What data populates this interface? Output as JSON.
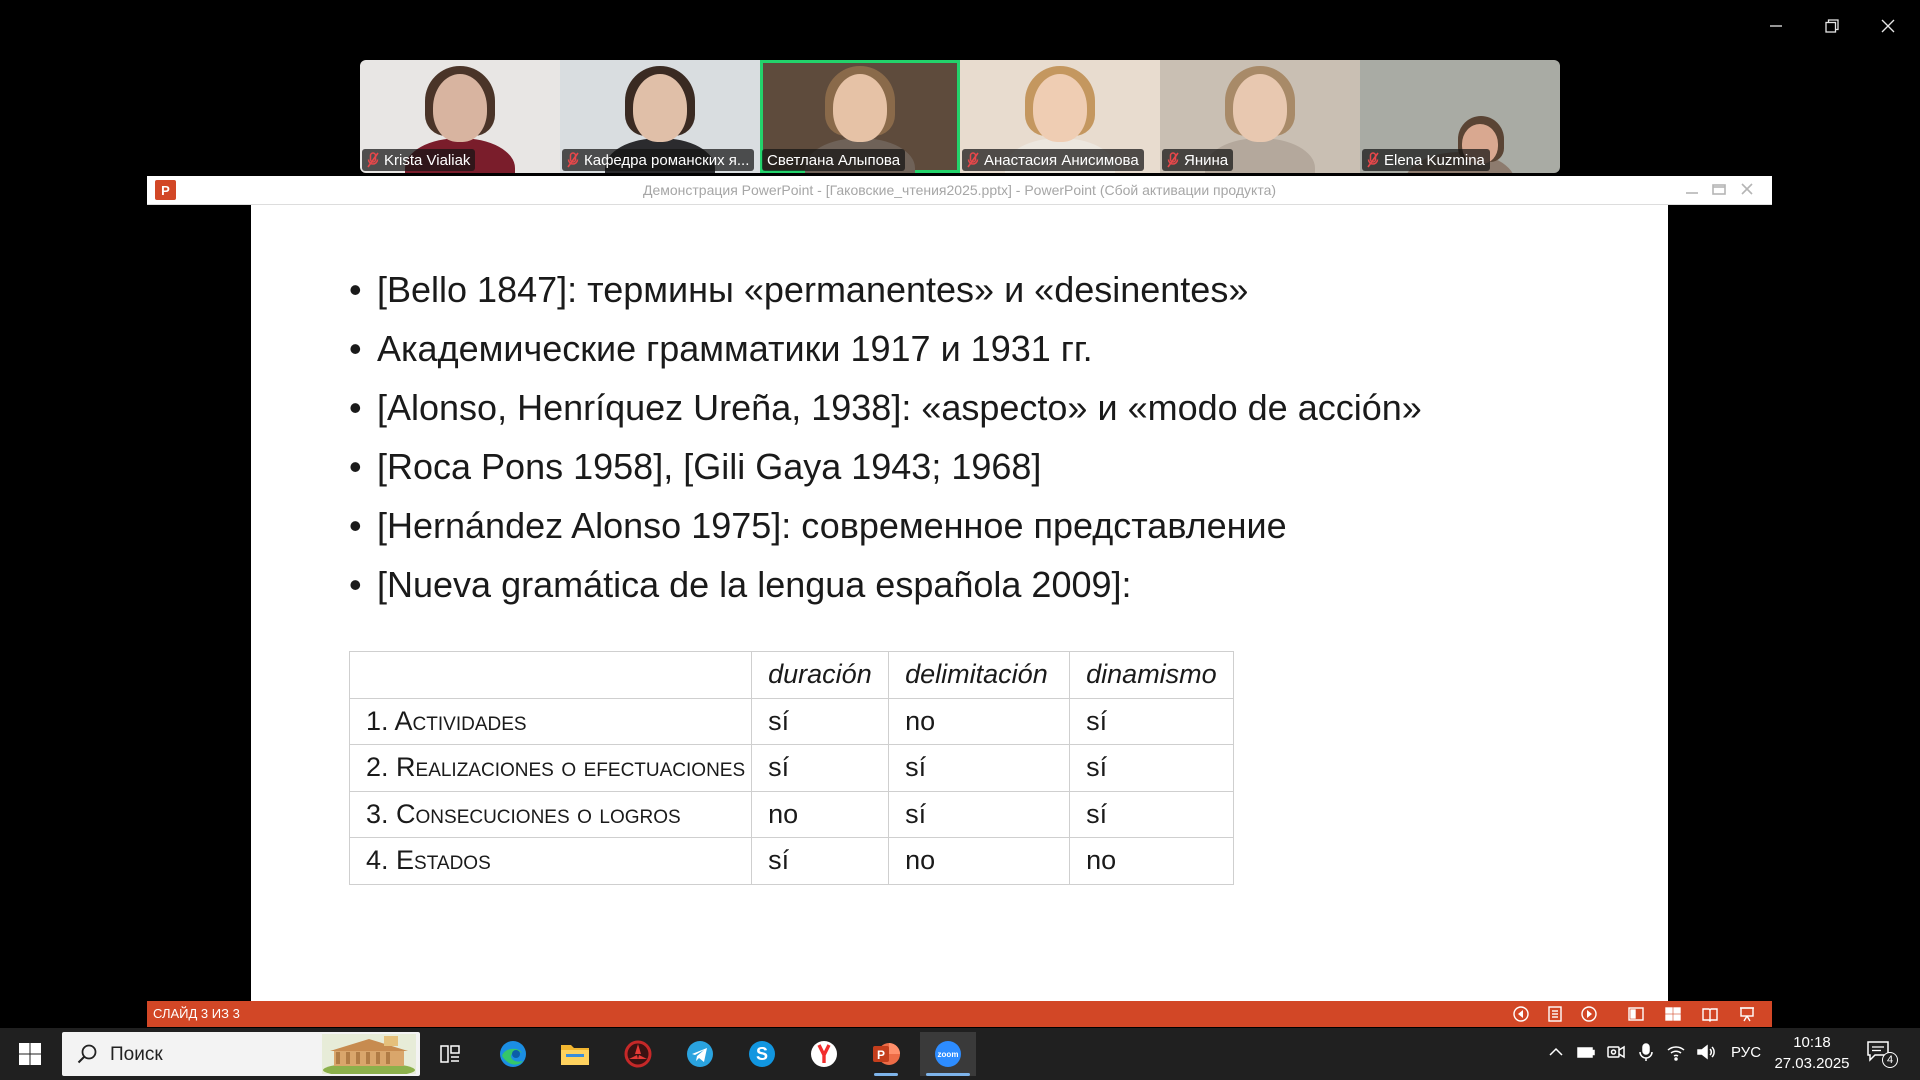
{
  "zoom_window": {
    "controls": [
      "minimize",
      "restore",
      "close"
    ]
  },
  "participants": [
    {
      "name": "Krista Vialiak",
      "muted": true,
      "active": false
    },
    {
      "name": "Кафедра романских я...",
      "muted": true,
      "active": false
    },
    {
      "name": "Светлана Алыпова",
      "muted": false,
      "active": true
    },
    {
      "name": "Анастасия Анисимова",
      "muted": true,
      "active": false
    },
    {
      "name": "Янина",
      "muted": true,
      "active": false
    },
    {
      "name": "Elena Kuzmina",
      "muted": true,
      "active": false
    }
  ],
  "ppt": {
    "logo_letter": "P",
    "title": "Демонстрация PowerPoint - [Гаковские_чтения2025.pptx] - PowerPoint (Сбой активации продукта)",
    "slide_counter": "СЛАЙД 3 ИЗ 3",
    "accent_color": "#d24726"
  },
  "slide": {
    "bullets": [
      "[Bello 1847]: термины «permanentes» и «desinentes»",
      "Академические грамматики 1917 и 1931 гг.",
      "[Alonso, Henríquez Ureña, 1938]: «aspecto» и «modo de acción»",
      "[Roca Pons 1958], [Gili Gaya 1943; 1968]",
      "[Hernández Alonso 1975]: современное представление",
      "[Nueva gramática de la lengua española 2009]:"
    ],
    "table": {
      "headers": [
        "",
        "duración",
        "delimitación",
        "dinamismo"
      ],
      "rows": [
        [
          "1. Actividades",
          "sí",
          "no",
          "sí"
        ],
        [
          "2. Realizaciones o efectuaciones",
          "sí",
          "sí",
          "sí"
        ],
        [
          "3. Consecuciones o logros",
          "no",
          "sí",
          "sí"
        ],
        [
          "4. Estados",
          "sí",
          "no",
          "no"
        ]
      ]
    }
  },
  "taskbar": {
    "search_placeholder": "Поиск",
    "apps": [
      "task-view",
      "edge",
      "file-explorer",
      "app-red-circle",
      "telegram",
      "skype",
      "yandex-browser",
      "powerpoint",
      "zoom"
    ],
    "language": "РУС",
    "time": "10:18",
    "date": "27.03.2025",
    "notification_count": "4"
  }
}
